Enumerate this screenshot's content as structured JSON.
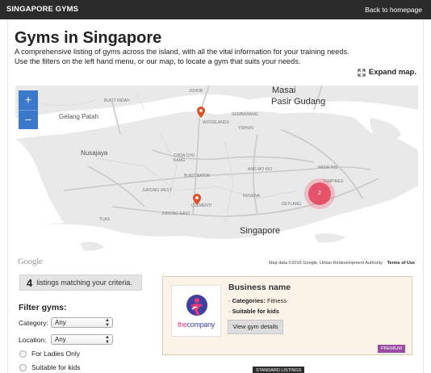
{
  "topbar": {
    "brand": "SINGAPORE GYMS",
    "back_link": "Back to homepage"
  },
  "page": {
    "title": "Gyms in Singapore",
    "intro_line1": "A comprehensive listing of gyms across the island, with all the vital information for your training needs.",
    "intro_line2": "Use the filters on the left hand menu, or our map, to locate a gym that suits your needs.",
    "expand_map": "Expand map."
  },
  "map": {
    "zoom_in": "+",
    "zoom_out": "−",
    "labels": {
      "masai": "Masai",
      "pasir_gudang": "Pasir Gudang",
      "gelang_patah": "Gelang Patah",
      "nusajaya": "Nusajaya",
      "bukit_indah": "BUKIT INDAH",
      "johor": "JOHOR",
      "sembawang": "SEMBAWANG",
      "woodlands": "WOODLANDS",
      "yishun": "YISHUN",
      "choa_chu_kang": "CHOA CHU KANG",
      "bukit_batok": "BUKIT BATOK",
      "jurong_west": "JURONG WEST",
      "jurong_east": "JURONG EAST",
      "clementi": "CLEMENTI",
      "ang_mo_kio": "ANG MO KIO",
      "novena": "NOVENA",
      "geylang": "GEYLANG",
      "pasir_ris": "PASIR RIS",
      "tampines": "TAMPINES",
      "tuas": "TUAS",
      "singapore": "Singapore"
    },
    "cluster_count": "2",
    "google": "Google",
    "map_data": "Map data ©2015 Google, Urban Redevelopment Authority",
    "terms": "Terms of Use",
    "colors": {
      "land": "#e9e9e9",
      "water": "#ffffff",
      "road": "#c9c9c9",
      "pin": "#d9522b",
      "cluster": "#e63755"
    }
  },
  "listings": {
    "count": "4",
    "text": "listings matching your criteria."
  },
  "filters": {
    "title": "Filter gyms:",
    "category_label": "Category:",
    "category_value": "Any",
    "location_label": "Location:",
    "location_value": "Any",
    "ladies_only": "For Ladies Only",
    "suitable_kids": "Suitable for kids"
  },
  "card": {
    "business_name": "Business name",
    "categories_label": "Categories:",
    "categories_value": "Fitness",
    "feature": "Suitable for kids",
    "view_button": "View gym details",
    "badge": "PREMIUM",
    "logo_text_a": "the",
    "logo_text_b": "company"
  },
  "standard_listings": "STANDARD LISTINGS"
}
